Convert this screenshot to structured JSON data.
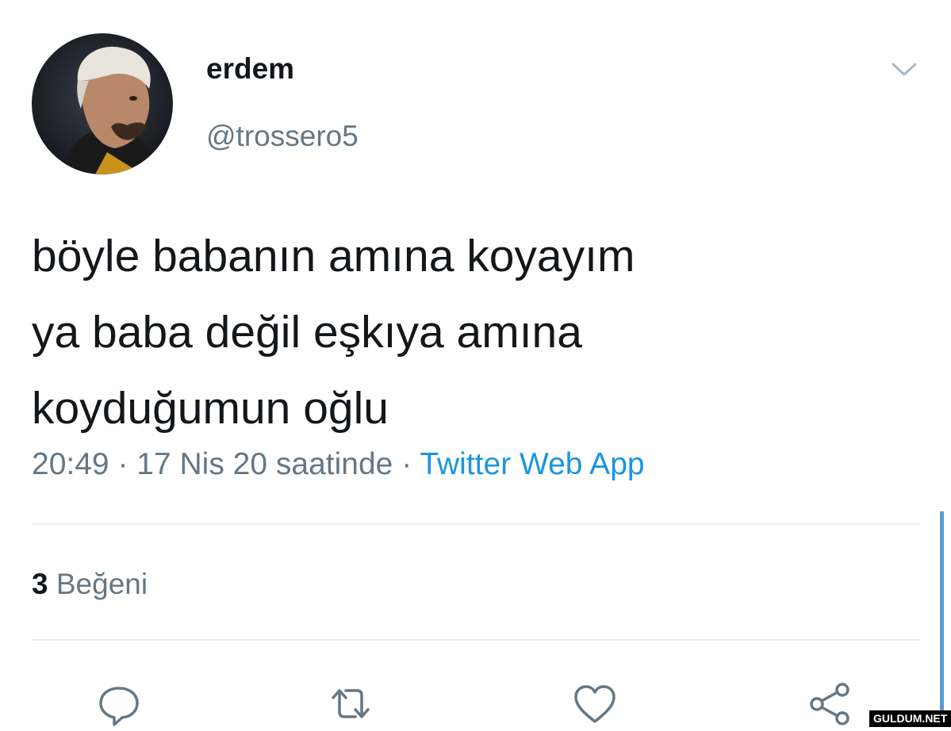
{
  "author": {
    "display_name": "erdem",
    "handle": "@trossero5"
  },
  "tweet": {
    "text_lines": [
      "böyle babanın amına koyayım",
      "ya baba değil eşkıya amına",
      "koyduğumun oğlu"
    ],
    "time": "20:49",
    "date": "17 Nis 20 saatinde",
    "separator": "·",
    "source": "Twitter Web App"
  },
  "stats": {
    "likes_count": "3",
    "likes_label": "Beğeni"
  },
  "actions": [
    {
      "icon": "reply-icon"
    },
    {
      "icon": "retweet-icon"
    },
    {
      "icon": "like-icon"
    },
    {
      "icon": "share-icon"
    }
  ],
  "watermark": "GULDUM.NET",
  "colors": {
    "text": "#14171a",
    "secondary": "#657786",
    "link": "#1b95e0",
    "divider": "#e6ecf0"
  }
}
